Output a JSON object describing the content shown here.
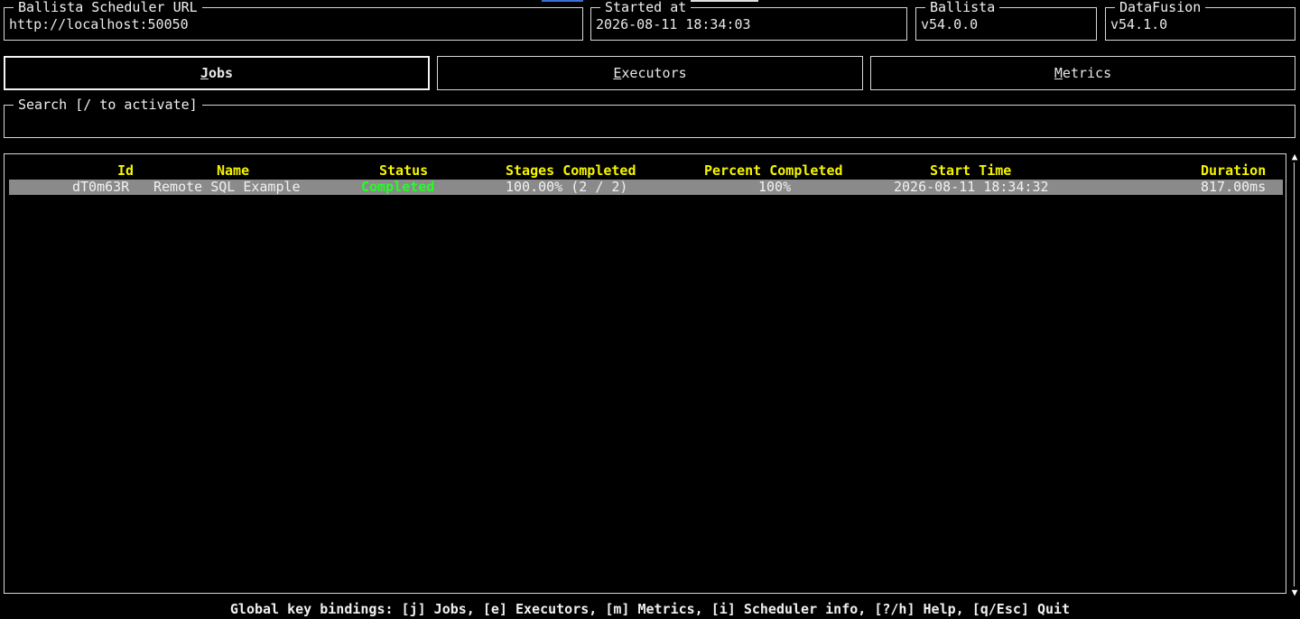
{
  "header": {
    "scheduler": {
      "title": "Ballista Scheduler URL",
      "value": "http://localhost:50050"
    },
    "started": {
      "title": "Started at",
      "value": "2026-08-11 18:34:03"
    },
    "ballista": {
      "title": "Ballista",
      "value": "v54.0.0"
    },
    "datafusion": {
      "title": "DataFusion",
      "value": "v54.1.0"
    }
  },
  "tabs": [
    {
      "hotkey": "J",
      "rest": "obs",
      "active": true
    },
    {
      "hotkey": "E",
      "rest": "xecutors",
      "active": false
    },
    {
      "hotkey": "M",
      "rest": "etrics",
      "active": false
    }
  ],
  "search": {
    "title": "Search [/ to activate]",
    "value": ""
  },
  "table": {
    "columns": [
      "Id",
      "Name",
      "Status",
      "Stages Completed",
      "Percent Completed",
      "Start Time",
      "Duration"
    ],
    "rows": [
      {
        "id": "dT0m63R",
        "name": "Remote SQL Example",
        "status": "Completed",
        "stages": "100.00% (2 / 2)",
        "percent": "100%",
        "start_time": "2026-08-11 18:34:32",
        "duration": "817.00ms"
      }
    ]
  },
  "scrollbar": {
    "up": "▲",
    "down": "▼"
  },
  "footer": "Global key bindings: [j] Jobs, [e] Executors, [m] Metrics, [i] Scheduler info, [?/h] Help, [q/Esc] Quit",
  "colors": {
    "background": "#000000",
    "header_text": "#f5f500",
    "status_completed": "#22ff22",
    "selected_row": "#8a8a8a",
    "tab_marker_blue": "#3a6fd8"
  }
}
